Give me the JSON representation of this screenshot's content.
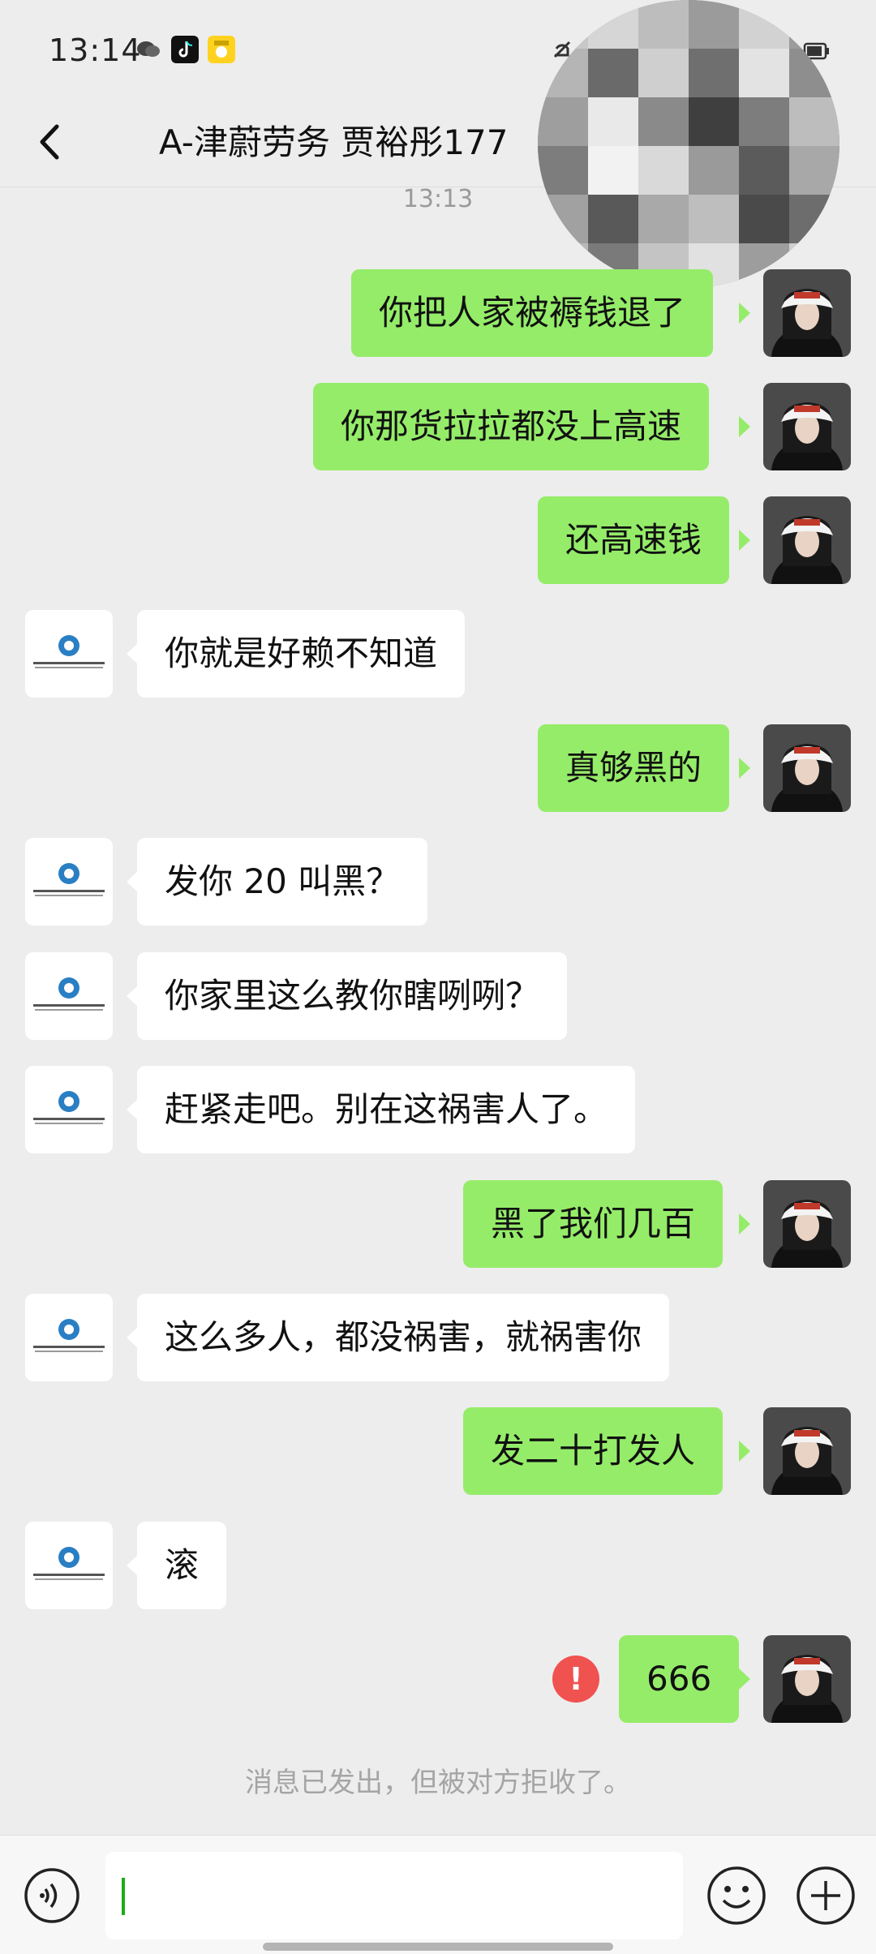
{
  "status_bar": {
    "time": "13:14"
  },
  "header": {
    "title": "A-津蔚劳务 贾裕彤177"
  },
  "timestamp": "13:13",
  "messages": [
    {
      "text": "你把人家被褥钱退了"
    },
    {
      "text": "你那货拉拉都没上高速"
    },
    {
      "text": "还高速钱"
    },
    {
      "text": "你就是好赖不知道"
    },
    {
      "text": "真够黑的"
    },
    {
      "text": "发你 20 叫黑？"
    },
    {
      "text": "你家里这么教你瞎咧咧？"
    },
    {
      "text": "赶紧走吧。别在这祸害人了。"
    },
    {
      "text": "黑了我们几百"
    },
    {
      "text": "这么多人，都没祸害，就祸害你"
    },
    {
      "text": "发二十打发人"
    },
    {
      "text": "滚"
    },
    {
      "text": "666",
      "status": "failed"
    }
  ],
  "error_mark": "!",
  "notice": "消息已发出，但被对方拒收了。",
  "colors": {
    "my_bubble": "#95ec69",
    "other_bubble": "#ffffff",
    "background": "#ededed",
    "error": "#f0524f"
  },
  "icons": [
    "back-arrow-icon",
    "voice-icon",
    "emoji-icon",
    "plus-icon"
  ]
}
